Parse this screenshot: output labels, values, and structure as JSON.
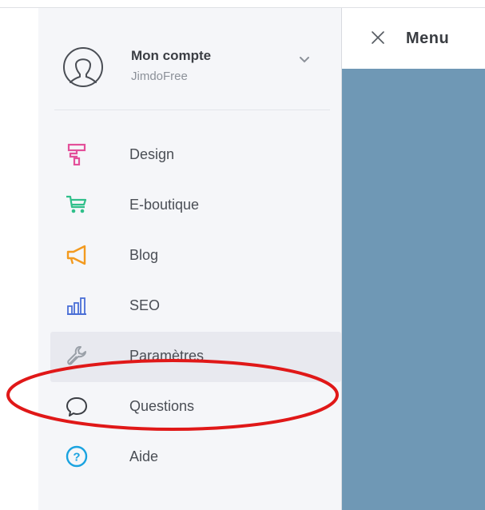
{
  "menu": {
    "label": "Menu",
    "close_icon": "close-icon"
  },
  "account": {
    "name": "Mon compte",
    "plan": "JimdoFree",
    "avatar_icon": "user-avatar-icon",
    "chevron_icon": "chevron-down-icon"
  },
  "nav": {
    "items": [
      {
        "label": "Design",
        "icon": "paint-roller-icon",
        "color": "#e3509a"
      },
      {
        "label": "E-boutique",
        "icon": "shopping-cart-icon",
        "color": "#2fbf8a"
      },
      {
        "label": "Blog",
        "icon": "megaphone-icon",
        "color": "#f39a1f"
      },
      {
        "label": "SEO",
        "icon": "bar-chart-icon",
        "color": "#4a6fd6"
      },
      {
        "label": "Paramètres",
        "icon": "wrench-icon",
        "color": "#9aa0a8"
      },
      {
        "label": "Questions",
        "icon": "speech-bubble-icon",
        "color": "#3b3e44"
      },
      {
        "label": "Aide",
        "icon": "help-icon",
        "color": "#1aa3e0"
      }
    ]
  },
  "colors": {
    "preview": "#6f98b5",
    "annotation": "#e01818"
  }
}
